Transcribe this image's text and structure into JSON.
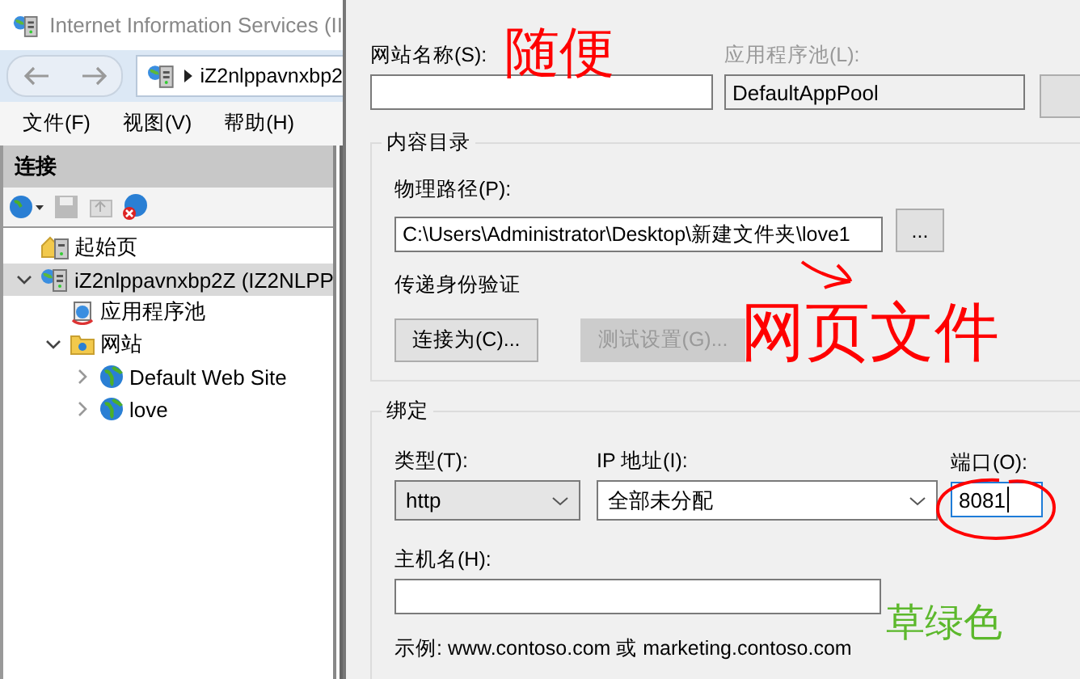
{
  "iis_window": {
    "title": "Internet Information Services (II",
    "address": "iZ2nlppavnxbp2",
    "menu": [
      "文件(F)",
      "视图(V)",
      "帮助(H)"
    ],
    "connections": {
      "title": "连接",
      "tree": [
        {
          "label": "起始页",
          "kind": "page",
          "expanded": false,
          "selected": false
        },
        {
          "label": "iZ2nlppavnxbp2Z (IZ2NLPP",
          "kind": "server",
          "expanded": true,
          "selected": true,
          "children": [
            {
              "label": "应用程序池",
              "kind": "pool",
              "expanded": false,
              "selected": false
            },
            {
              "label": "网站",
              "kind": "folder",
              "expanded": true,
              "selected": false,
              "children": [
                {
                  "label": "Default Web Site",
                  "kind": "site",
                  "expanded": false,
                  "selected": false
                },
                {
                  "label": "love",
                  "kind": "site",
                  "expanded": false,
                  "selected": false
                }
              ]
            }
          ]
        }
      ]
    }
  },
  "dialog": {
    "site_name": {
      "label": "网站名称(S):"
    },
    "app_pool": {
      "label": "应用程序池(L):",
      "value": "DefaultAppPool",
      "disabled": true
    },
    "content_directory": {
      "title": "内容目录",
      "physical_path": {
        "label": "物理路径(P):",
        "value": "C:\\Users\\Administrator\\Desktop\\新建文件夹\\love1"
      },
      "browse_button": "...",
      "pass_through_auth": "传递身份验证",
      "buttons": [
        {
          "label": "连接为(C)...",
          "disabled": false
        },
        {
          "label": "测试设置(G)...",
          "disabled": true
        }
      ]
    },
    "binding": {
      "title": "绑定",
      "type": {
        "label": "类型(T):",
        "value": "http"
      },
      "ip": {
        "label": "IP 地址(I):",
        "value": "全部未分配"
      },
      "port": {
        "label": "端口(O):",
        "value": "8081",
        "focused": true
      },
      "host": {
        "label": "主机名(H):"
      },
      "example": "示例: www.contoso.com 或 marketing.contoso.com"
    }
  },
  "annotations": [
    {
      "text": "随便",
      "color": "#ff0000"
    },
    {
      "text": "网页文件",
      "color": "#ff0000"
    },
    {
      "text": "草绿色",
      "color": "#5cb82c"
    }
  ]
}
